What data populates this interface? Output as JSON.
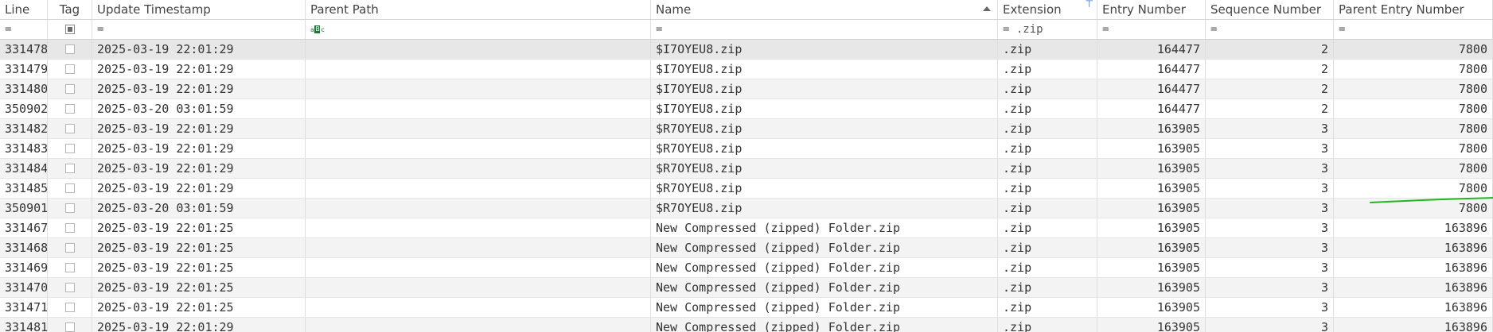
{
  "columns": {
    "line": "Line",
    "tag": "Tag",
    "update_timestamp": "Update Timestamp",
    "parent_path": "Parent Path",
    "name": "Name",
    "extension": "Extension",
    "entry_number": "Entry Number",
    "sequence_number": "Sequence Number",
    "parent_entry_number": "Parent Entry Number"
  },
  "filters": {
    "line": "=",
    "update_timestamp": "=",
    "name": "=",
    "extension": "= .zip",
    "entry_number": "=",
    "sequence_number": "=",
    "parent_entry_number": "=",
    "parent_path_icon": "abc-filter-icon"
  },
  "sort": {
    "column": "name",
    "direction": "ascending"
  },
  "rows": [
    {
      "line": "331478",
      "ts": "2025-03-19 22:01:29",
      "parent_path": "",
      "name": "$I7OYEU8.zip",
      "ext": ".zip",
      "entry": "164477",
      "seq": "2",
      "pen": "7800"
    },
    {
      "line": "331479",
      "ts": "2025-03-19 22:01:29",
      "parent_path": "",
      "name": "$I7OYEU8.zip",
      "ext": ".zip",
      "entry": "164477",
      "seq": "2",
      "pen": "7800"
    },
    {
      "line": "331480",
      "ts": "2025-03-19 22:01:29",
      "parent_path": "",
      "name": "$I7OYEU8.zip",
      "ext": ".zip",
      "entry": "164477",
      "seq": "2",
      "pen": "7800"
    },
    {
      "line": "350902",
      "ts": "2025-03-20 03:01:59",
      "parent_path": "",
      "name": "$I7OYEU8.zip",
      "ext": ".zip",
      "entry": "164477",
      "seq": "2",
      "pen": "7800"
    },
    {
      "line": "331482",
      "ts": "2025-03-19 22:01:29",
      "parent_path": "",
      "name": "$R7OYEU8.zip",
      "ext": ".zip",
      "entry": "163905",
      "seq": "3",
      "pen": "7800"
    },
    {
      "line": "331483",
      "ts": "2025-03-19 22:01:29",
      "parent_path": "",
      "name": "$R7OYEU8.zip",
      "ext": ".zip",
      "entry": "163905",
      "seq": "3",
      "pen": "7800"
    },
    {
      "line": "331484",
      "ts": "2025-03-19 22:01:29",
      "parent_path": "",
      "name": "$R7OYEU8.zip",
      "ext": ".zip",
      "entry": "163905",
      "seq": "3",
      "pen": "7800"
    },
    {
      "line": "331485",
      "ts": "2025-03-19 22:01:29",
      "parent_path": "",
      "name": "$R7OYEU8.zip",
      "ext": ".zip",
      "entry": "163905",
      "seq": "3",
      "pen": "7800"
    },
    {
      "line": "350901",
      "ts": "2025-03-20 03:01:59",
      "parent_path": "",
      "name": "$R7OYEU8.zip",
      "ext": ".zip",
      "entry": "163905",
      "seq": "3",
      "pen": "7800"
    },
    {
      "line": "331467",
      "ts": "2025-03-19 22:01:25",
      "parent_path": "",
      "name": "New Compressed (zipped) Folder.zip",
      "ext": ".zip",
      "entry": "163905",
      "seq": "3",
      "pen": "163896"
    },
    {
      "line": "331468",
      "ts": "2025-03-19 22:01:25",
      "parent_path": "",
      "name": "New Compressed (zipped) Folder.zip",
      "ext": ".zip",
      "entry": "163905",
      "seq": "3",
      "pen": "163896"
    },
    {
      "line": "331469",
      "ts": "2025-03-19 22:01:25",
      "parent_path": "",
      "name": "New Compressed (zipped) Folder.zip",
      "ext": ".zip",
      "entry": "163905",
      "seq": "3",
      "pen": "163896"
    },
    {
      "line": "331470",
      "ts": "2025-03-19 22:01:25",
      "parent_path": "",
      "name": "New Compressed (zipped) Folder.zip",
      "ext": ".zip",
      "entry": "163905",
      "seq": "3",
      "pen": "163896"
    },
    {
      "line": "331471",
      "ts": "2025-03-19 22:01:25",
      "parent_path": "",
      "name": "New Compressed (zipped) Folder.zip",
      "ext": ".zip",
      "entry": "163905",
      "seq": "3",
      "pen": "163896"
    },
    {
      "line": "331481",
      "ts": "2025-03-19 22:01:29",
      "parent_path": "",
      "name": "New Compressed (zipped) Folder.zip",
      "ext": ".zip",
      "entry": "163905",
      "seq": "3",
      "pen": "163896"
    }
  ],
  "colors": {
    "alt_row": "#f3f3f3",
    "selected_row": "#e7e7e7",
    "annotation": "#1fb81f"
  }
}
